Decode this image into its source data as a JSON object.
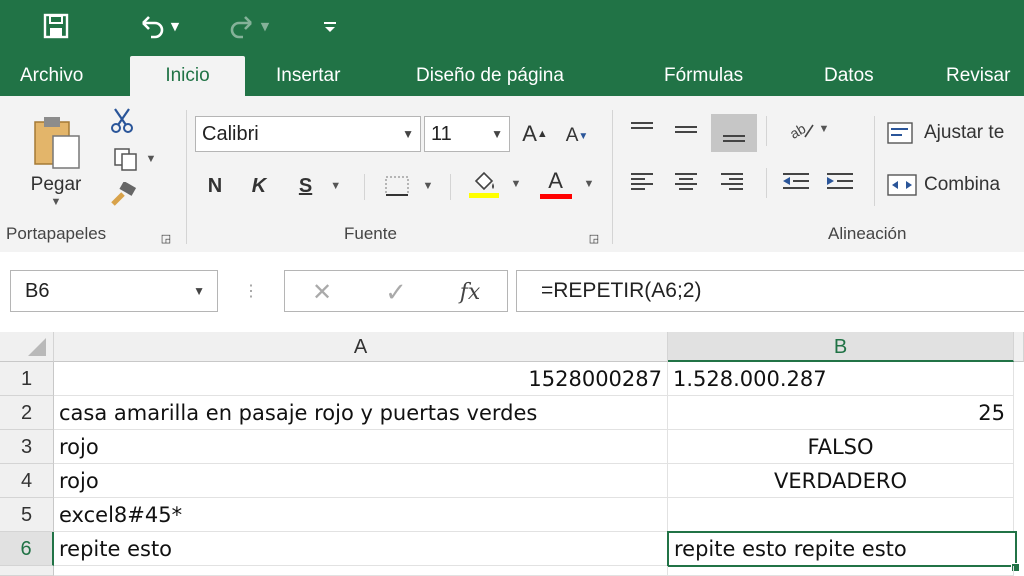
{
  "ribbon_tabs": [
    "Archivo",
    "Inicio",
    "Insertar",
    "Diseño de página",
    "Fórmulas",
    "Datos",
    "Revisar"
  ],
  "active_tab": "Inicio",
  "clipboard": {
    "paste_label": "Pegar",
    "group_label": "Portapapeles"
  },
  "font": {
    "name": "Calibri",
    "size": "11",
    "bold": "N",
    "italic": "K",
    "underline": "S",
    "grow": "A",
    "shrink": "A",
    "color_letter": "A",
    "group_label": "Fuente",
    "fill_color": "#ffff00",
    "text_color": "#ff0000"
  },
  "alignment": {
    "wrap_label": "Ajustar te",
    "merge_label": "Combina",
    "group_label": "Alineación"
  },
  "formula_bar": {
    "name_box": "B6",
    "fx_label": "fx",
    "formula": "=REPETIR(A6;2)"
  },
  "columns": [
    "A",
    "B"
  ],
  "selected_column": "B",
  "selected_row": "6",
  "rows": [
    {
      "num": "1",
      "a": "1528000287",
      "b": "1.528.000.287"
    },
    {
      "num": "2",
      "a": "casa amarilla en pasaje rojo y puertas verdes",
      "b": "25"
    },
    {
      "num": "3",
      "a": "rojo",
      "b": "FALSO"
    },
    {
      "num": "4",
      "a": "rojo",
      "b": "VERDADERO"
    },
    {
      "num": "5",
      "a": "excel8#45*",
      "b": ""
    },
    {
      "num": "6",
      "a": "repite esto",
      "b": "repite esto repite esto"
    }
  ],
  "colors": {
    "excel_green": "#217346",
    "ribbon_bg": "#f3f3f3"
  }
}
